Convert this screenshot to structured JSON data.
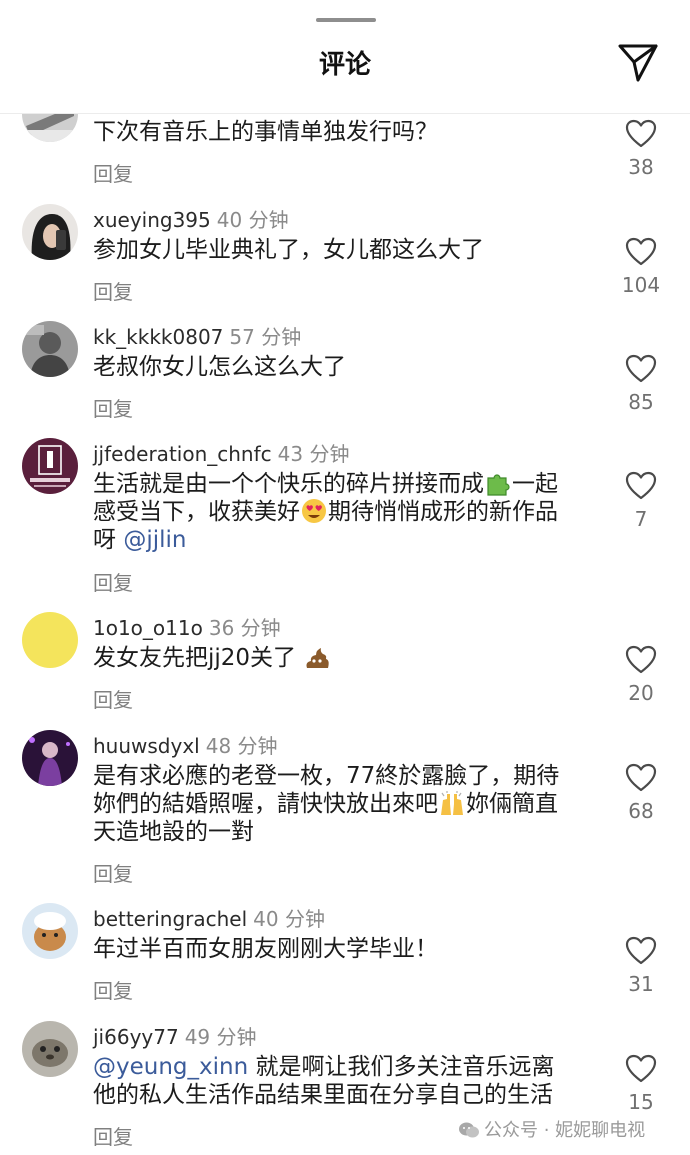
{
  "header": {
    "title": "评论"
  },
  "comments": [
    {
      "username": "",
      "time": "",
      "text": "下次有音乐上的事情单独发行吗？",
      "reply": "回复",
      "likes": "38"
    },
    {
      "username": "xueying395",
      "time": "40 分钟",
      "text": "参加女儿毕业典礼了，女儿都这么大了",
      "reply": "回复",
      "likes": "104"
    },
    {
      "username": "kk_kkkk0807",
      "time": "57 分钟",
      "text": "老叔你女儿怎么这么大了",
      "reply": "回复",
      "likes": "85"
    },
    {
      "username": "jjfederation_chnfc",
      "time": "43 分钟",
      "text_line1_a": "生活就是由一个个快乐的碎片拼接而成",
      "emoji_1": "puzzle-piece-emoji",
      "text_line1_b": "一起",
      "text_line2_a": "感受当下，收获美好",
      "emoji_2": "heart-eyes-emoji",
      "text_line2_b": "期待悄悄成形的新作品",
      "text_line3_a": "呀 ",
      "mention": "@jjlin",
      "reply": "回复",
      "likes": "7"
    },
    {
      "username": "1o1o_o11o",
      "time": "36 分钟",
      "text": "发女友先把jj20关了",
      "emoji": "poop-emoji",
      "reply": "回复",
      "likes": "20"
    },
    {
      "username": "huuwsdyxl",
      "time": "48 分钟",
      "text_line1": "是有求必應的老登一枚，77終於露臉了，期待",
      "text_line2_a": "妳們的結婚照喔，請快快放出來吧",
      "emoji": "raising-hands-emoji",
      "text_line2_b": "妳倆簡直",
      "text_line3": "天造地設的一對",
      "reply": "回复",
      "likes": "68"
    },
    {
      "username": "betteringrachel",
      "time": "40 分钟",
      "text": "年过半百而女朋友刚刚大学毕业！",
      "reply": "回复",
      "likes": "31"
    },
    {
      "username": "ji66yy77",
      "time": "49 分钟",
      "mention": "@yeung_xinn",
      "text_line1_b": " 就是啊让我们多关注音乐远离",
      "text_line2": "他的私人生活作品结果里面在分享自己的生活",
      "reply": "回复",
      "likes": "15"
    }
  ],
  "watermark": "公众号 · 妮妮聊电视",
  "icons": {
    "share": "send-icon",
    "like": "heart-outline-icon"
  },
  "colors": {
    "mention": "#3b5b9a",
    "secondary_text": "#8a8a8a"
  }
}
